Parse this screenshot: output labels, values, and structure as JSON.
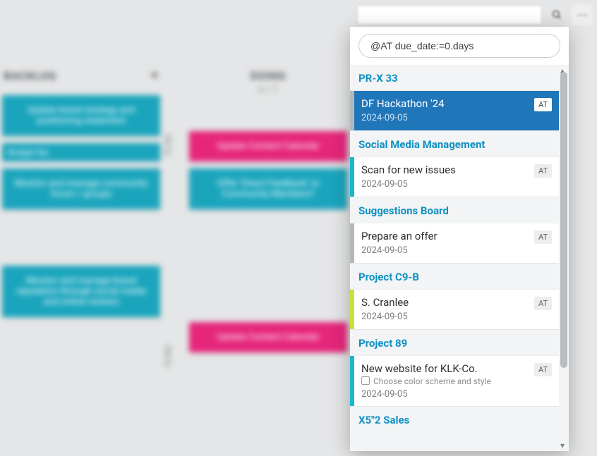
{
  "query": "@AT due_date:=0.days",
  "columns": {
    "backlog": {
      "title": "BACKLOG"
    },
    "doing": {
      "title": "DOING",
      "count": "6 / 7"
    }
  },
  "bg_cards": {
    "c1": "Update brand strategy and positioning statement",
    "c2": "Budget fee",
    "c3": "Monitor and manage community forum / groups",
    "c4": "Monitor and manage brand reputation through social media and online reviews",
    "d1": "Update Content Calendar",
    "d2": "Offer 'Direct Feedback' to Community Members?",
    "d3": "Update Content Calendar"
  },
  "swimlane": "TO DO",
  "groups": [
    {
      "name": "PR-X 33",
      "items": [
        {
          "title": "DF Hackathon '24",
          "date": "2024-09-05",
          "tag": "AT",
          "bar": "c-gray",
          "selected": true
        }
      ]
    },
    {
      "name": "Social Media Management",
      "items": [
        {
          "title": "Scan for new issues",
          "date": "2024-09-05",
          "tag": "AT",
          "bar": "c-teal"
        }
      ]
    },
    {
      "name": "Suggestions Board",
      "items": [
        {
          "title": "Prepare an offer",
          "date": "2024-09-05",
          "tag": "AT",
          "bar": "c-gray"
        }
      ]
    },
    {
      "name": "Project C9-B",
      "items": [
        {
          "title": "S. Cranlee",
          "date": "2024-09-05",
          "tag": "AT",
          "bar": "c-lime"
        }
      ]
    },
    {
      "name": "Project 89",
      "items": [
        {
          "title": "New website for KLK-Co.",
          "subtask": "Choose color scheme and style",
          "date": "2024-09-05",
          "tag": "AT",
          "bar": "c-teal"
        }
      ]
    },
    {
      "name": "X5\"2 Sales",
      "items": []
    }
  ]
}
